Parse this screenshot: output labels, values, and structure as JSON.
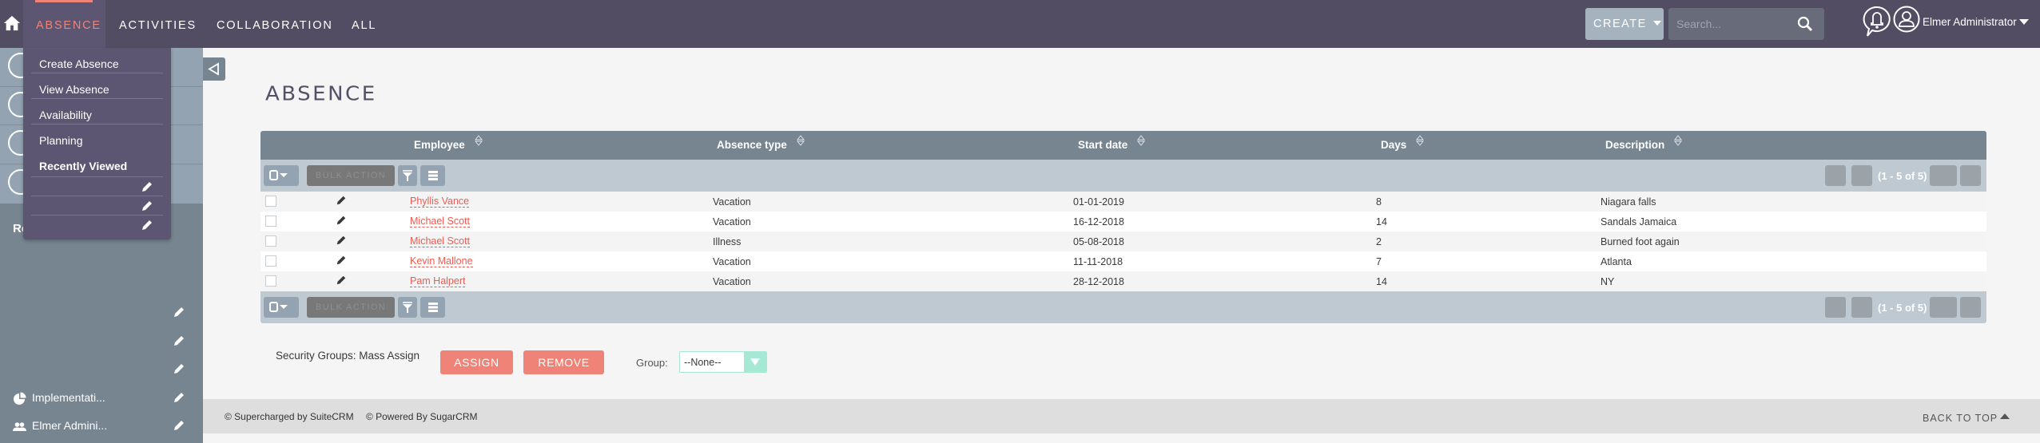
{
  "topnav": {
    "tabs": [
      {
        "label": "ABSENCE",
        "active": true
      },
      {
        "label": "ACTIVITIES"
      },
      {
        "label": "COLLABORATION"
      },
      {
        "label": "ALL"
      }
    ],
    "create_label": "CREATE",
    "search_placeholder": "Search...",
    "user_name": "Elmer Administrator"
  },
  "dropdown": {
    "items": [
      "Create Absence",
      "View Absence",
      "Availability",
      "Planning"
    ],
    "recently_viewed_label": "Recently Viewed"
  },
  "sidebar": {
    "recent_title": "Re",
    "recent_items": [
      {
        "label": ""
      },
      {
        "label": ""
      },
      {
        "label": ""
      },
      {
        "label": "Implementati...",
        "icon": "pie-chart-icon"
      },
      {
        "label": "Elmer Admini...",
        "icon": "users-icon"
      }
    ]
  },
  "main": {
    "title": "ABSENCE",
    "columns": [
      "Employee",
      "Absence type",
      "Start date",
      "Days",
      "Description"
    ],
    "bulk_action_label": "BULK ACTION",
    "pagination_text": "(1 - 5 of 5)",
    "rows": [
      {
        "employee": "Phyllis Vance",
        "type": "Vacation",
        "start": "01-01-2019",
        "days": "8",
        "description": "Niagara falls"
      },
      {
        "employee": "Michael Scott",
        "type": "Vacation",
        "start": "16-12-2018",
        "days": "14",
        "description": "Sandals Jamaica"
      },
      {
        "employee": "Michael Scott",
        "type": "Illness",
        "start": "05-08-2018",
        "days": "2",
        "description": "Burned foot again"
      },
      {
        "employee": "Kevin Mallone",
        "type": "Vacation",
        "start": "11-11-2018",
        "days": "7",
        "description": "Atlanta"
      },
      {
        "employee": "Pam Halpert",
        "type": "Vacation",
        "start": "28-12-2018",
        "days": "14",
        "description": "NY"
      }
    ],
    "mass_assign": {
      "label": "Security Groups: Mass Assign",
      "assign_label": "ASSIGN",
      "remove_label": "REMOVE",
      "group_label": "Group:",
      "group_value": "--None--"
    }
  },
  "footer": {
    "suitecrm": "© Supercharged by SuiteCRM",
    "sugarcrm": "© Powered By SugarCRM",
    "back_to_top": "BACK TO TOP"
  },
  "colors": {
    "nav_bg": "#534d64",
    "accent": "#f08377",
    "sidebar_bg": "#778591",
    "link": "#f05a50",
    "select_accent": "#a5e8d4"
  }
}
